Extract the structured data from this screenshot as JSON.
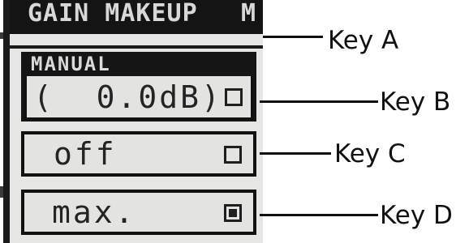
{
  "screen": {
    "header_title": "GAIN MAKEUP",
    "header_mode": "M",
    "section_label": "MANUAL"
  },
  "buttons": [
    {
      "key": "b",
      "text": "(  0.0dB)",
      "checked": false
    },
    {
      "key": "c",
      "text": "off",
      "checked": false
    },
    {
      "key": "d",
      "text": "max.",
      "checked": true
    }
  ],
  "callouts": {
    "key_a": "Key A",
    "key_b": "Key B",
    "key_c": "Key C",
    "key_d": "Key D"
  },
  "colors": {
    "lcd_background": "#e6e6e4",
    "lcd_dark": "#141414"
  }
}
